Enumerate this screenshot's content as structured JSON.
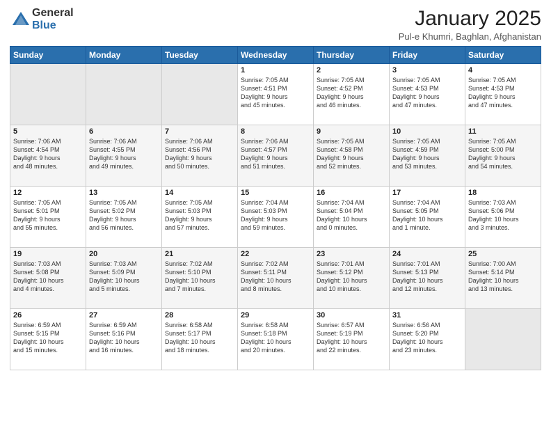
{
  "logo": {
    "general": "General",
    "blue": "Blue"
  },
  "title": "January 2025",
  "location": "Pul-e Khumri, Baghlan, Afghanistan",
  "weekdays": [
    "Sunday",
    "Monday",
    "Tuesday",
    "Wednesday",
    "Thursday",
    "Friday",
    "Saturday"
  ],
  "weeks": [
    [
      {
        "num": "",
        "detail": ""
      },
      {
        "num": "",
        "detail": ""
      },
      {
        "num": "",
        "detail": ""
      },
      {
        "num": "1",
        "detail": "Sunrise: 7:05 AM\nSunset: 4:51 PM\nDaylight: 9 hours\nand 45 minutes."
      },
      {
        "num": "2",
        "detail": "Sunrise: 7:05 AM\nSunset: 4:52 PM\nDaylight: 9 hours\nand 46 minutes."
      },
      {
        "num": "3",
        "detail": "Sunrise: 7:05 AM\nSunset: 4:53 PM\nDaylight: 9 hours\nand 47 minutes."
      },
      {
        "num": "4",
        "detail": "Sunrise: 7:05 AM\nSunset: 4:53 PM\nDaylight: 9 hours\nand 47 minutes."
      }
    ],
    [
      {
        "num": "5",
        "detail": "Sunrise: 7:06 AM\nSunset: 4:54 PM\nDaylight: 9 hours\nand 48 minutes."
      },
      {
        "num": "6",
        "detail": "Sunrise: 7:06 AM\nSunset: 4:55 PM\nDaylight: 9 hours\nand 49 minutes."
      },
      {
        "num": "7",
        "detail": "Sunrise: 7:06 AM\nSunset: 4:56 PM\nDaylight: 9 hours\nand 50 minutes."
      },
      {
        "num": "8",
        "detail": "Sunrise: 7:06 AM\nSunset: 4:57 PM\nDaylight: 9 hours\nand 51 minutes."
      },
      {
        "num": "9",
        "detail": "Sunrise: 7:05 AM\nSunset: 4:58 PM\nDaylight: 9 hours\nand 52 minutes."
      },
      {
        "num": "10",
        "detail": "Sunrise: 7:05 AM\nSunset: 4:59 PM\nDaylight: 9 hours\nand 53 minutes."
      },
      {
        "num": "11",
        "detail": "Sunrise: 7:05 AM\nSunset: 5:00 PM\nDaylight: 9 hours\nand 54 minutes."
      }
    ],
    [
      {
        "num": "12",
        "detail": "Sunrise: 7:05 AM\nSunset: 5:01 PM\nDaylight: 9 hours\nand 55 minutes."
      },
      {
        "num": "13",
        "detail": "Sunrise: 7:05 AM\nSunset: 5:02 PM\nDaylight: 9 hours\nand 56 minutes."
      },
      {
        "num": "14",
        "detail": "Sunrise: 7:05 AM\nSunset: 5:03 PM\nDaylight: 9 hours\nand 57 minutes."
      },
      {
        "num": "15",
        "detail": "Sunrise: 7:04 AM\nSunset: 5:03 PM\nDaylight: 9 hours\nand 59 minutes."
      },
      {
        "num": "16",
        "detail": "Sunrise: 7:04 AM\nSunset: 5:04 PM\nDaylight: 10 hours\nand 0 minutes."
      },
      {
        "num": "17",
        "detail": "Sunrise: 7:04 AM\nSunset: 5:05 PM\nDaylight: 10 hours\nand 1 minute."
      },
      {
        "num": "18",
        "detail": "Sunrise: 7:03 AM\nSunset: 5:06 PM\nDaylight: 10 hours\nand 3 minutes."
      }
    ],
    [
      {
        "num": "19",
        "detail": "Sunrise: 7:03 AM\nSunset: 5:08 PM\nDaylight: 10 hours\nand 4 minutes."
      },
      {
        "num": "20",
        "detail": "Sunrise: 7:03 AM\nSunset: 5:09 PM\nDaylight: 10 hours\nand 5 minutes."
      },
      {
        "num": "21",
        "detail": "Sunrise: 7:02 AM\nSunset: 5:10 PM\nDaylight: 10 hours\nand 7 minutes."
      },
      {
        "num": "22",
        "detail": "Sunrise: 7:02 AM\nSunset: 5:11 PM\nDaylight: 10 hours\nand 8 minutes."
      },
      {
        "num": "23",
        "detail": "Sunrise: 7:01 AM\nSunset: 5:12 PM\nDaylight: 10 hours\nand 10 minutes."
      },
      {
        "num": "24",
        "detail": "Sunrise: 7:01 AM\nSunset: 5:13 PM\nDaylight: 10 hours\nand 12 minutes."
      },
      {
        "num": "25",
        "detail": "Sunrise: 7:00 AM\nSunset: 5:14 PM\nDaylight: 10 hours\nand 13 minutes."
      }
    ],
    [
      {
        "num": "26",
        "detail": "Sunrise: 6:59 AM\nSunset: 5:15 PM\nDaylight: 10 hours\nand 15 minutes."
      },
      {
        "num": "27",
        "detail": "Sunrise: 6:59 AM\nSunset: 5:16 PM\nDaylight: 10 hours\nand 16 minutes."
      },
      {
        "num": "28",
        "detail": "Sunrise: 6:58 AM\nSunset: 5:17 PM\nDaylight: 10 hours\nand 18 minutes."
      },
      {
        "num": "29",
        "detail": "Sunrise: 6:58 AM\nSunset: 5:18 PM\nDaylight: 10 hours\nand 20 minutes."
      },
      {
        "num": "30",
        "detail": "Sunrise: 6:57 AM\nSunset: 5:19 PM\nDaylight: 10 hours\nand 22 minutes."
      },
      {
        "num": "31",
        "detail": "Sunrise: 6:56 AM\nSunset: 5:20 PM\nDaylight: 10 hours\nand 23 minutes."
      },
      {
        "num": "",
        "detail": ""
      }
    ]
  ]
}
